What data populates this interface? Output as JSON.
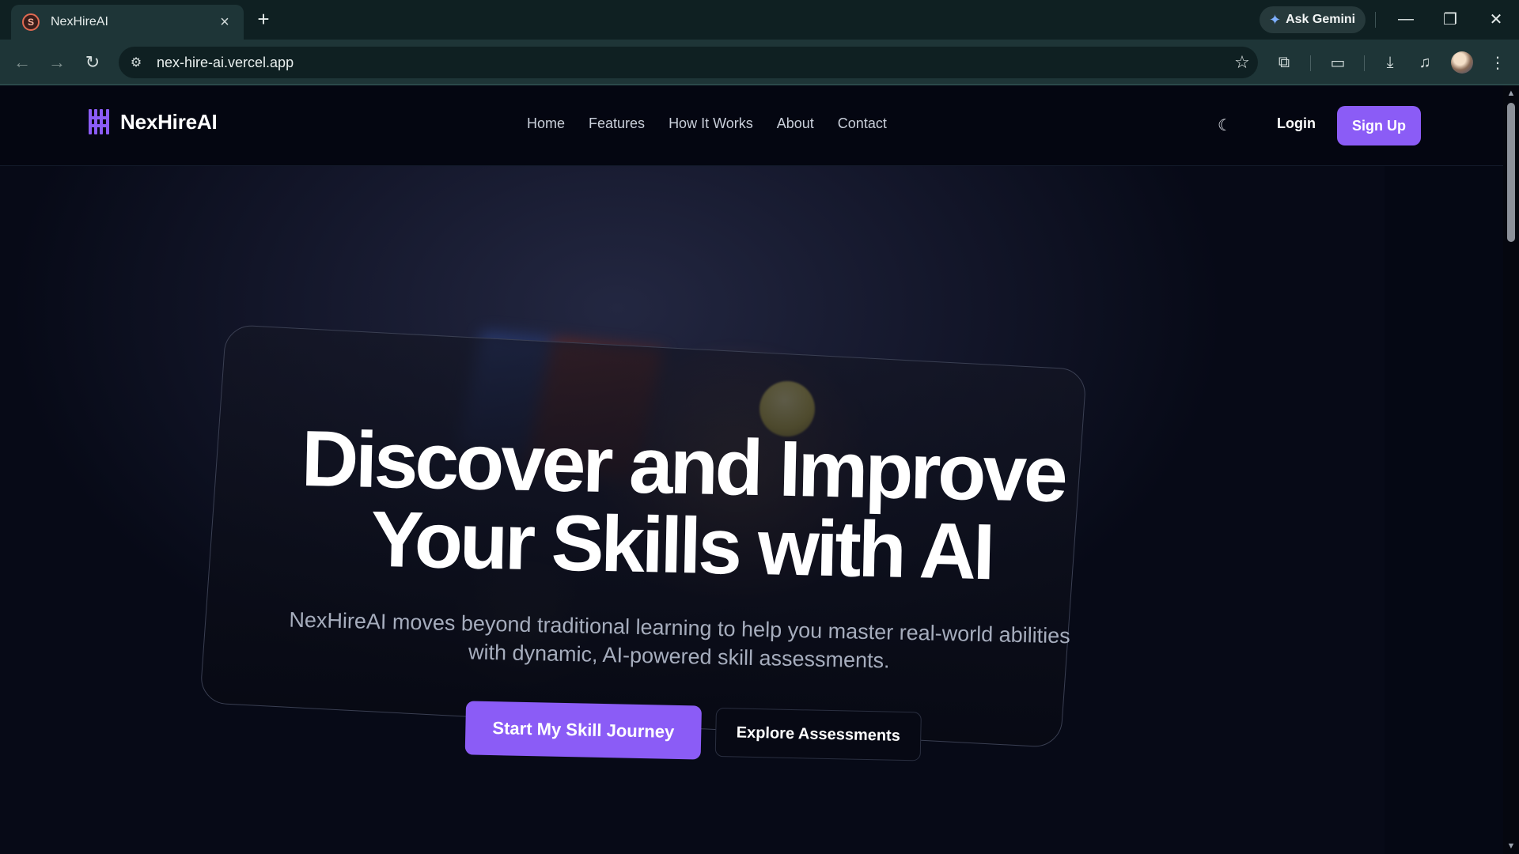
{
  "browser": {
    "tab_title": "NexHireAI",
    "favicon_glyph": "S",
    "url": "nex-hire-ai.vercel.app",
    "gemini_label": "Ask Gemini",
    "icons": {
      "close": "×",
      "new_tab": "+",
      "back": "←",
      "forward": "→",
      "reload": "↻",
      "site_info": "⚙",
      "star": "☆",
      "extensions": "⧉",
      "cast": "▭",
      "download": "⤓",
      "media": "♫",
      "menu": "⋮",
      "minimize": "—",
      "restore": "❐",
      "window_close": "✕"
    }
  },
  "site": {
    "logo_text": "NexHireAI",
    "nav": [
      "Home",
      "Features",
      "How It Works",
      "About",
      "Contact"
    ],
    "theme_icon": "☾",
    "login_label": "Login",
    "signup_label": "Sign Up",
    "accent_color": "#8b5cf6"
  },
  "hero": {
    "headline_line1": "Discover and Improve",
    "headline_line2": "Your Skills with AI",
    "subtitle_line1": "NexHireAI moves beyond traditional learning to help you master real-world abilities",
    "subtitle_line2": "with dynamic, AI-powered skill assessments.",
    "primary_cta": "Start My Skill Journey",
    "secondary_cta": "Explore Assessments"
  },
  "scrollbar": {
    "up": "▲",
    "down": "▼"
  }
}
